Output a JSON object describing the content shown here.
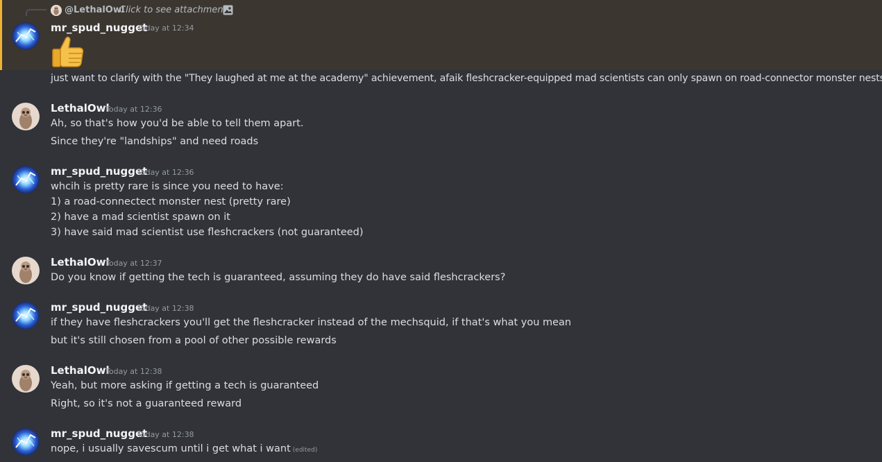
{
  "reply_preview": {
    "mention": "@LethalOwl",
    "hint": "Click to see attachment",
    "attachment_icon": "image-icon"
  },
  "colors": {
    "background": "#313338",
    "highlight_bg": "#3b3630",
    "highlight_bar": "#f0b232",
    "username": "#f2f3f5",
    "timestamp": "#949ba4",
    "text": "#dbdee1"
  },
  "messages": [
    {
      "author": "mr_spud_nugget",
      "timestamp": "Today at 12:34",
      "emoji": "thumbs-up",
      "lines": [
        "just want to clarify with the \"They laughed at me at the academy\" achievement, afaik fleshcracker-equipped mad scientists can only spawn on road-connector monster nests"
      ]
    },
    {
      "author": "LethalOwl",
      "timestamp": "Today at 12:36",
      "lines": [
        "Ah, so that's how you'd be able to tell them apart.",
        "Since they're \"landships\" and need roads"
      ]
    },
    {
      "author": "mr_spud_nugget",
      "timestamp": "Today at 12:36",
      "lines": [
        "whcih is pretty rare is since you need to have:",
        "1) a road-connectect monster nest (pretty rare)",
        "2) have a mad scientist spawn on it",
        "3) have said mad scientist use fleshcrackers (not guaranteed)"
      ]
    },
    {
      "author": "LethalOwl",
      "timestamp": "Today at 12:37",
      "lines": [
        "Do you know if getting the tech is guaranteed, assuming they do have said fleshcrackers?"
      ]
    },
    {
      "author": "mr_spud_nugget",
      "timestamp": "Today at 12:38",
      "lines": [
        "if they have fleshcrackers you'll get the fleshcracker instead of the mechsquid, if that's what you mean",
        "but it's still chosen from a pool of other possible rewards"
      ]
    },
    {
      "author": "LethalOwl",
      "timestamp": "Today at 12:38",
      "lines": [
        "Yeah, but more asking if getting a tech is guaranteed",
        "Right, so it's not a guaranteed reward"
      ]
    },
    {
      "author": "mr_spud_nugget",
      "timestamp": "Today at 12:38",
      "lines": [
        "nope, i usually savescum until i get what i want"
      ],
      "edited_label": "(edited)"
    }
  ]
}
